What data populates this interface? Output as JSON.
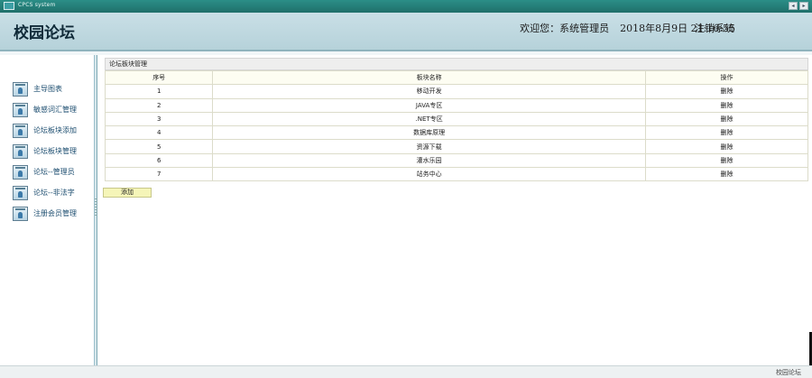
{
  "window": {
    "title": "CPCS system",
    "buttons": [
      "◂",
      "▸"
    ]
  },
  "header": {
    "title": "校园论坛",
    "welcome": "欢迎您：系统管理员",
    "datetime": "2018年8月9日 21:16:55",
    "logout": "注销系统"
  },
  "sidebar": {
    "items": [
      {
        "label": "主导图表",
        "icon": "menu-icon"
      },
      {
        "label": "敏感词汇管理",
        "icon": "menu-icon"
      },
      {
        "label": "论坛板块添加",
        "icon": "menu-icon"
      },
      {
        "label": "论坛板块管理",
        "icon": "menu-icon"
      },
      {
        "label": "论坛--管理员",
        "icon": "menu-icon"
      },
      {
        "label": "论坛--非法字",
        "icon": "menu-icon"
      },
      {
        "label": "注册会员管理",
        "icon": "menu-icon"
      }
    ]
  },
  "panel": {
    "title": "论坛板块管理",
    "columns": [
      "序号",
      "板块名称",
      "操作"
    ],
    "rows": [
      {
        "idx": "1",
        "name": "移动开发",
        "op": "删除"
      },
      {
        "idx": "2",
        "name": "JAVA专区",
        "op": "删除"
      },
      {
        "idx": "3",
        "name": ".NET专区",
        "op": "删除"
      },
      {
        "idx": "4",
        "name": "数据库原理",
        "op": "删除"
      },
      {
        "idx": "5",
        "name": "资源下载",
        "op": "删除"
      },
      {
        "idx": "6",
        "name": "灌水乐园",
        "op": "删除"
      },
      {
        "idx": "7",
        "name": "站务中心",
        "op": "删除"
      }
    ],
    "add_label": "添加"
  },
  "footer": {
    "text": "校园论坛"
  }
}
